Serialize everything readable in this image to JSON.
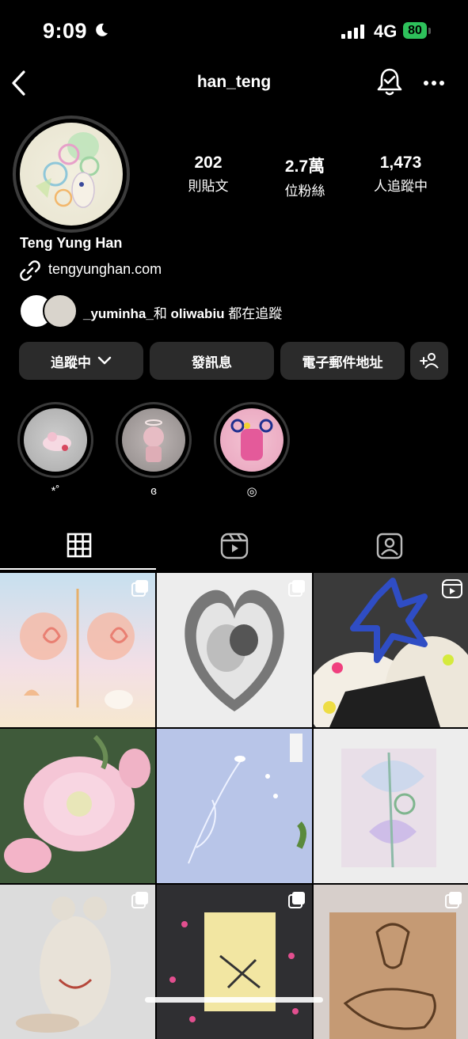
{
  "status_bar": {
    "time": "9:09",
    "network": "4G",
    "battery": "80"
  },
  "header": {
    "username": "han_teng"
  },
  "profile": {
    "display_name": "Teng Yung Han",
    "website": "tengyunghan.com",
    "stats": [
      {
        "value": "202",
        "label": "則貼文"
      },
      {
        "value": "2.7萬",
        "label": "位粉絲"
      },
      {
        "value": "1,473",
        "label": "人追蹤中"
      }
    ],
    "mutual": {
      "user1": "_yuminha_",
      "conj": "和",
      "user2": "oliwabiu",
      "suffix": "都在追蹤"
    }
  },
  "buttons": {
    "following": "追蹤中",
    "message": "發訊息",
    "email": "電子郵件地址"
  },
  "highlights": [
    {
      "label": "*˚"
    },
    {
      "label": "ɞ"
    },
    {
      "label": "◎"
    }
  ],
  "colors": {
    "background": "#000000",
    "button_bg": "#2b2b2b",
    "battery": "#2ec15b"
  }
}
